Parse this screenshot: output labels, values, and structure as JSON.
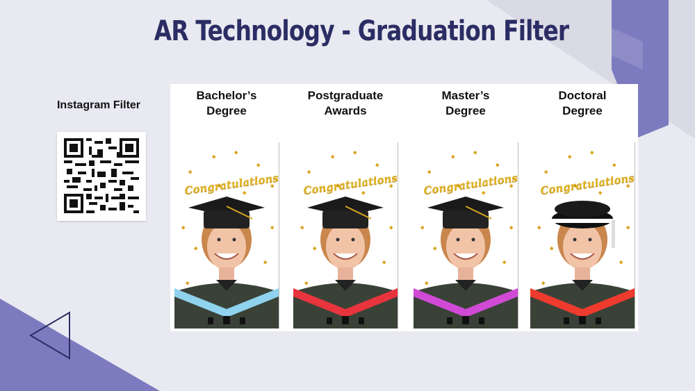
{
  "page": {
    "title": "AR Technology - Graduation Filter"
  },
  "instagram": {
    "label": "Instagram Filter",
    "qr_icon": "qr-code-icon"
  },
  "filters": [
    {
      "label": "Bachelor’s\nDegree",
      "banner": "Congratulations!",
      "hood_color": "#8fd3ee",
      "cap": "mortarboard"
    },
    {
      "label": "Postgraduate\nAwards",
      "banner": "Congratulations!",
      "hood_color": "#e8343c",
      "cap": "mortarboard"
    },
    {
      "label": "Master’s\nDegree",
      "banner": "Congratulations!",
      "hood_color": "#d04ad6",
      "cap": "mortarboard"
    },
    {
      "label": "Doctoral\nDegree",
      "banner": "Congratulations!",
      "hood_color": "#ef3a2e",
      "cap": "bonnet"
    }
  ],
  "navigation": {
    "prev_icon": "triangle-left-icon"
  },
  "colors": {
    "title": "#2b2d64",
    "accent_purple": "#7c7cbe",
    "background": "#e9eaf1"
  }
}
